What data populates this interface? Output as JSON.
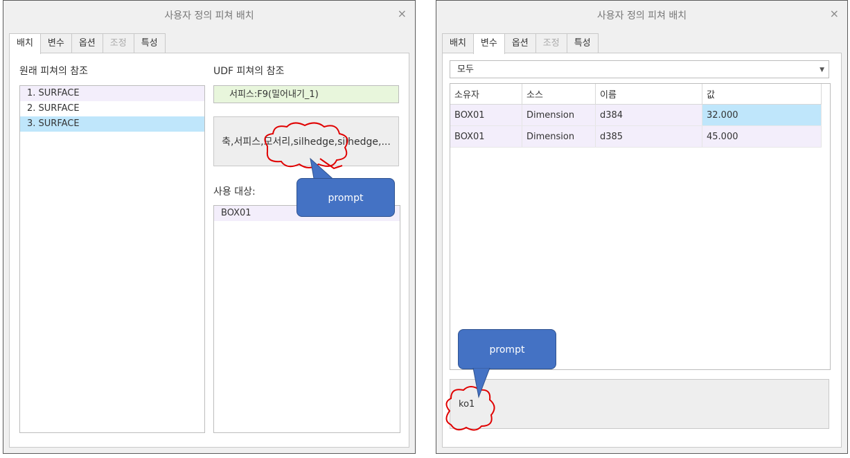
{
  "left_dialog": {
    "title": "사용자 정의 피쳐 배치",
    "close_label": "×",
    "tabs": [
      {
        "label": "배치",
        "active": true,
        "enabled": true
      },
      {
        "label": "변수",
        "active": false,
        "enabled": true
      },
      {
        "label": "옵션",
        "active": false,
        "enabled": true
      },
      {
        "label": "조정",
        "active": false,
        "enabled": false
      },
      {
        "label": "특성",
        "active": false,
        "enabled": true
      }
    ],
    "original_refs_label": "원래 피쳐의 참조",
    "original_refs": [
      "1. SURFACE",
      "2. SURFACE",
      "3. SURFACE"
    ],
    "selected_ref_index": 2,
    "udf_refs_label": "UDF 피쳐의 참조",
    "udf_ref_value": "서피스:F9(밀어내기_1)",
    "filter_button_label": "축,서피스,모서리,silhedge,silhedge,...",
    "usage_label": "사용 대상:",
    "usage_items": [
      "BOX01"
    ],
    "callout_text": "prompt"
  },
  "right_dialog": {
    "title": "사용자 정의 피쳐 배치",
    "close_label": "×",
    "tabs": [
      {
        "label": "배치",
        "active": false,
        "enabled": true
      },
      {
        "label": "변수",
        "active": true,
        "enabled": true
      },
      {
        "label": "옵션",
        "active": false,
        "enabled": true
      },
      {
        "label": "조정",
        "active": false,
        "enabled": false
      },
      {
        "label": "특성",
        "active": false,
        "enabled": true
      }
    ],
    "filter_value": "모두",
    "columns": [
      "소유자",
      "소스",
      "이름",
      "값"
    ],
    "rows": [
      {
        "owner": "BOX01",
        "source": "Dimension",
        "name": "d384",
        "value": "32.000"
      },
      {
        "owner": "BOX01",
        "source": "Dimension",
        "name": "d385",
        "value": "45.000"
      }
    ],
    "message_text": "ko1",
    "callout_text": "prompt"
  },
  "colors": {
    "selection": "#bfe6fb",
    "row_alt": "#f3eefb",
    "ref_box": "#e8f6dc",
    "callout_fill": "#4472c4",
    "cloud_outline": "#e00000"
  }
}
